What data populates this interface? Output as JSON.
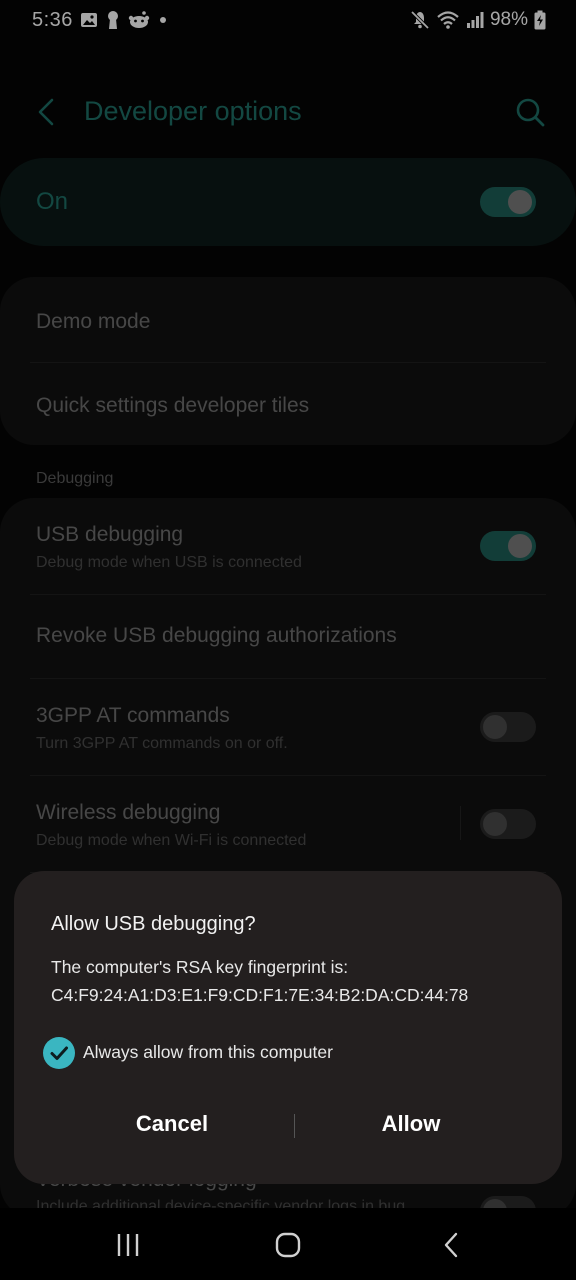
{
  "status_bar": {
    "time": "5:36",
    "battery": "98%",
    "left_icons": [
      "gallery-icon",
      "keyhole-icon",
      "reddit-icon",
      "dot-icon"
    ],
    "right_icons": [
      "mute-icon",
      "wifi-icon",
      "signal-icon",
      "battery-charging-icon"
    ]
  },
  "app_bar": {
    "title": "Developer options"
  },
  "master_switch": {
    "label": "On",
    "state": "on"
  },
  "general": {
    "items": [
      {
        "title": "Demo mode"
      },
      {
        "title": "Quick settings developer tiles"
      }
    ]
  },
  "debugging": {
    "header": "Debugging",
    "items": [
      {
        "title": "USB debugging",
        "subtitle": "Debug mode when USB is connected",
        "toggle": "on"
      },
      {
        "title": "Revoke USB debugging authorizations"
      },
      {
        "title": "3GPP AT commands",
        "subtitle": "Turn 3GPP AT commands on or off.",
        "toggle": "off"
      },
      {
        "title": "Wireless debugging",
        "subtitle": "Debug mode when Wi-Fi is connected",
        "toggle": "off"
      },
      {
        "title": "Verbose vendor logging",
        "subtitle": "Include additional device-specific vendor logs in bug",
        "toggle": "off"
      }
    ]
  },
  "dialog": {
    "title": "Allow USB debugging?",
    "body_line1": "The computer's RSA key fingerprint is:",
    "body_line2": "C4:F9:24:A1:D3:E1:F9:CD:F1:7E:34:B2:DA:CD:44:78",
    "checkbox_label": "Always allow from this computer",
    "checkbox_checked": true,
    "cancel_label": "Cancel",
    "allow_label": "Allow"
  },
  "colors": {
    "accent": "#1e6f66",
    "checkbox": "#3ab6c1",
    "dialog_bg": "#231f1f"
  },
  "nav_bar": {
    "buttons": [
      "recents-icon",
      "home-icon",
      "back-icon"
    ]
  }
}
